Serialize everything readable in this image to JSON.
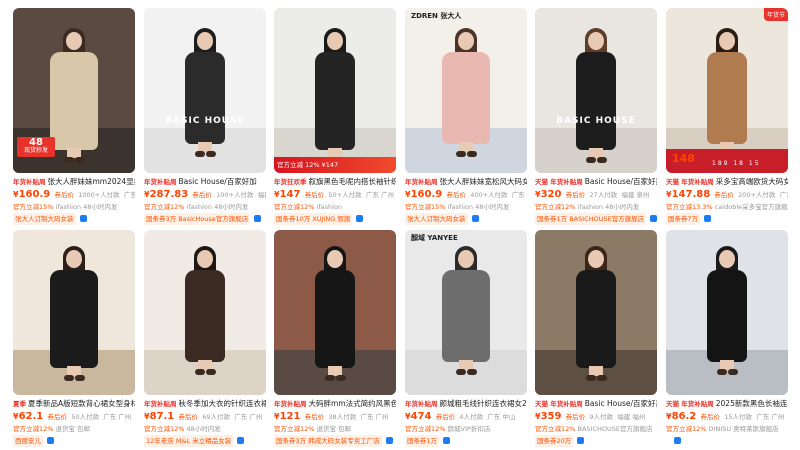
{
  "products": [
    {
      "tag": "年货补贴周",
      "title": "张大人胖妹妹mm2024显瘦",
      "price": "160.9",
      "price_tag": "券后价",
      "sales": "1000+人付款",
      "location": "广东",
      "discount": "官方立减15%",
      "shop": "ifashion 48小时内发",
      "shop_tag": "张大人订制大码女装",
      "overlay": {
        "top": "48",
        "bottom": "现货秒发"
      },
      "colors": {
        "wall": "#5a4a42",
        "floor": "#3b332e",
        "dress": "#d8c7a8",
        "hair": "#3a2a22"
      }
    },
    {
      "tag": "年货补贴周",
      "title": "Basic House/百家好加",
      "price": "287.83",
      "price_tag": "券后价",
      "sales": "100+人付款",
      "location": "福建",
      "discount": "官方立减12%",
      "shop": "ifashion 48小时内发",
      "shop_tag": "国条券3万 BasicHouse官方旗舰店",
      "overlay": {
        "center": "BASIC HOUSE"
      },
      "colors": {
        "wall": "#f2f2f2",
        "floor": "#e2e2e2",
        "dress": "#2b2b2b",
        "hair": "#1e1e1e"
      }
    },
    {
      "tag": "年货狂欢季",
      "title": "叙旗黑色毛呢内搭长袖针织",
      "price": "147",
      "price_tag": "券后价",
      "sales": "50+人付款",
      "location": "广东 广州",
      "discount": "官方立减12%",
      "shop": "ifashion",
      "shop_tag": "国条券10万 XUJING 叙旗",
      "overlay": {
        "bottom": "官方立减 12% ¥147"
      },
      "colors": {
        "wall": "#ececea",
        "floor": "#d9d6d0",
        "dress": "#242424",
        "hair": "#1b1b1b"
      }
    },
    {
      "tag": "年货补贴周",
      "title": "张大人胖妹妹宽松风大码女装",
      "price": "160.9",
      "price_tag": "券后价",
      "sales": "400+人付款",
      "location": "广东 广州",
      "discount": "官方立减15%",
      "shop": "ifashion 48小时内发",
      "shop_tag": "张大人订制大码女装",
      "overlay": {
        "logo": "ZDREN 张大人"
      },
      "colors": {
        "wall": "#f3efe9",
        "floor": "#cfd6e0",
        "dress": "#e9b8b0",
        "hair": "#4a3328"
      }
    },
    {
      "tag": "天猫 年货补贴周",
      "title": "Basic House/百家好黑色",
      "price": "320",
      "price_tag": "券后价",
      "sales": "27人付款",
      "location": "福建 泉州",
      "discount": "官方立减12%",
      "shop": "ifashion 48小时内发",
      "shop_tag": "国条券1万 BASICHOUSE官方旗舰店",
      "overlay": {
        "center": "BASIC HOUSE"
      },
      "colors": {
        "wall": "#e9e6e2",
        "floor": "#d6d1ca",
        "dress": "#1d1d1d",
        "hair": "#5e3e2a"
      }
    },
    {
      "tag": "天猫 年货补贴周",
      "title": "采多宝高端欧货大码女装",
      "price": "147.88",
      "price_tag": "券后价",
      "sales": "200+人付款",
      "location": "广东 广州",
      "discount": "官方立减13.3%",
      "shop": "caidoble采多宝官方旗舰店",
      "shop_tag": "国条券7万",
      "overlay": {
        "corner": "年货节",
        "price": "148",
        "nums": "189 18 15"
      },
      "colors": {
        "wall": "#ece6dc",
        "floor": "#d8cfc2",
        "dress": "#b07c4f",
        "hair": "#2a1d16"
      }
    },
    {
      "tag": "夏季",
      "title": "夏季新品A版短款背心裙女型身材",
      "price": "62.1",
      "price_tag": "券后价",
      "sales": "50人付款",
      "location": "广东 广州",
      "discount": "官方立减12%",
      "shop": "退货宝 包邮",
      "shop_tag": "西丽安儿",
      "overlay": {},
      "colors": {
        "wall": "#efe7db",
        "floor": "#c9b79e",
        "dress": "#1b1b1b",
        "hair": "#2b1f1a"
      }
    },
    {
      "tag": "年货补贴周",
      "title": "秋冬季加大衣的针织连衣裙女",
      "price": "87.1",
      "price_tag": "券后价",
      "sales": "69人付款",
      "location": "广东 广州",
      "discount": "官方立减12%",
      "shop": "48小时内发",
      "shop_tag": "12年老店 M&L 米立精品女装",
      "overlay": {},
      "colors": {
        "wall": "#f0ebe4",
        "floor": "#ddd3c6",
        "dress": "#3b2a22",
        "hair": "#1e1713"
      }
    },
    {
      "tag": "年货补贴周",
      "title": "大码胖mm法式简约风黑色连衣裙",
      "price": "121",
      "price_tag": "券后价",
      "sales": "38人付款",
      "location": "广东 广州",
      "discount": "官方立减12%",
      "shop": "退货宝 包邮",
      "shop_tag": "国条券3万 韩成大码女装专卖工厂店",
      "overlay": {},
      "colors": {
        "wall": "#8c5a46",
        "floor": "#5a4a44",
        "dress": "#161616",
        "hair": "#151515"
      }
    },
    {
      "tag": "年货补贴周",
      "title": "颜城粗毛线针织连衣裙女2024",
      "price": "474",
      "price_tag": "券后价",
      "sales": "4人付款",
      "location": "广东 中山",
      "discount": "官方立减12%",
      "shop": "颜城VIP折扣店",
      "shop_tag": "国条券1万",
      "overlay": {
        "logo": "顏域 YANYEE"
      },
      "colors": {
        "wall": "#e9e9e9",
        "floor": "#dcdcdc",
        "dress": "#6d6d6d",
        "hair": "#2b2b2b"
      }
    },
    {
      "tag": "天猫 年货补贴周",
      "title": "Basic House/百家好黑色羊毛",
      "price": "359",
      "price_tag": "券后价",
      "sales": "9人付款",
      "location": "福建 福州",
      "discount": "官方立减12%",
      "shop": "BASICHOUSE官方旗舰店",
      "shop_tag": "国条券20万",
      "overlay": {},
      "colors": {
        "wall": "#8b7a66",
        "floor": "#5d4f42",
        "dress": "#1a1a1a",
        "hair": "#3a2518"
      }
    },
    {
      "tag": "天猫 年货补贴周",
      "title": "2025新款黑色长袖连衣裙女",
      "price": "86.2",
      "price_tag": "券后价",
      "sales": "15人付款",
      "location": "广东 广州",
      "discount": "官方立减12%",
      "shop": "DINISU 奥特莱斯旗舰店",
      "shop_tag": "",
      "overlay": {},
      "colors": {
        "wall": "#dfe3e8",
        "floor": "#b9bec4",
        "dress": "#141414",
        "hair": "#1b1b1b"
      }
    }
  ]
}
